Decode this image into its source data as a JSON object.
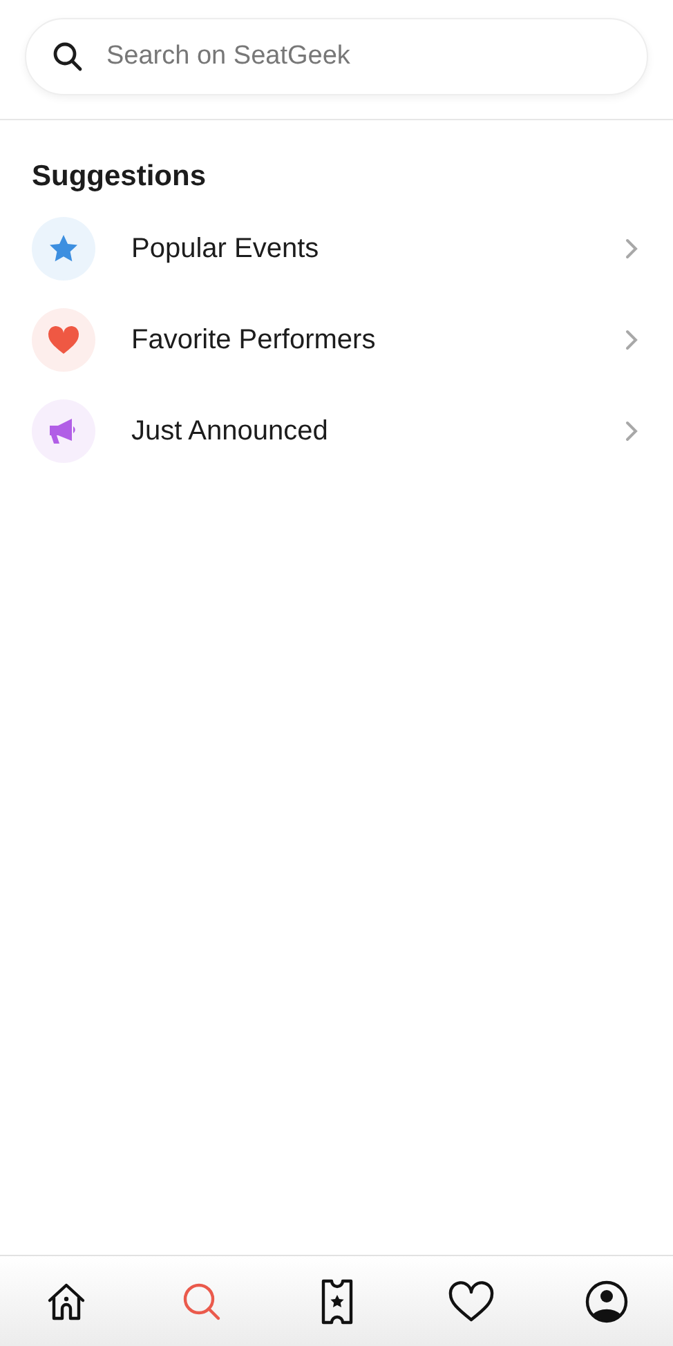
{
  "search": {
    "placeholder": "Search on SeatGeek"
  },
  "suggestions": {
    "title": "Suggestions",
    "items": [
      {
        "kind": "star",
        "label": "Popular Events",
        "color": "#3d8fe0"
      },
      {
        "kind": "heart",
        "label": "Favorite Performers",
        "color": "#ef5843"
      },
      {
        "kind": "megaphone",
        "label": "Just Announced",
        "color": "#b15ee6"
      }
    ]
  },
  "tab_bar": [
    {
      "kind": "home",
      "selected": false
    },
    {
      "kind": "search",
      "selected": true
    },
    {
      "kind": "ticket",
      "selected": false
    },
    {
      "kind": "heart",
      "selected": false
    },
    {
      "kind": "account",
      "selected": false
    }
  ]
}
